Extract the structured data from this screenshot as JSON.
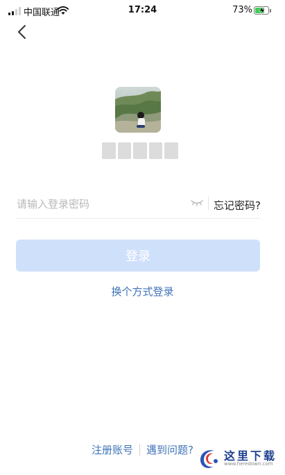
{
  "status_bar": {
    "carrier": "中国联通",
    "time": "17:24",
    "battery_percent": "73%",
    "battery_level": 0.73,
    "icons": [
      "signal-icon",
      "wifi-icon",
      "battery-icon",
      "charging-bolt-icon"
    ]
  },
  "nav": {
    "back_icon": "chevron-left-icon"
  },
  "profile": {
    "avatar_icon": "user-avatar-photo"
  },
  "password": {
    "placeholder": "请输入登录密码",
    "value": "",
    "toggle_icon": "eye-closed-icon",
    "forgot_label": "忘记密码?"
  },
  "login": {
    "button_label": "登录",
    "button_color": "#cfe0fb",
    "switch_method_label": "换个方式登录"
  },
  "footer": {
    "register_label": "注册账号",
    "help_label": "遇到问题?",
    "link_color": "#3f73b8"
  },
  "watermark": {
    "title": "这里下载",
    "url": "www.heredown.com"
  }
}
